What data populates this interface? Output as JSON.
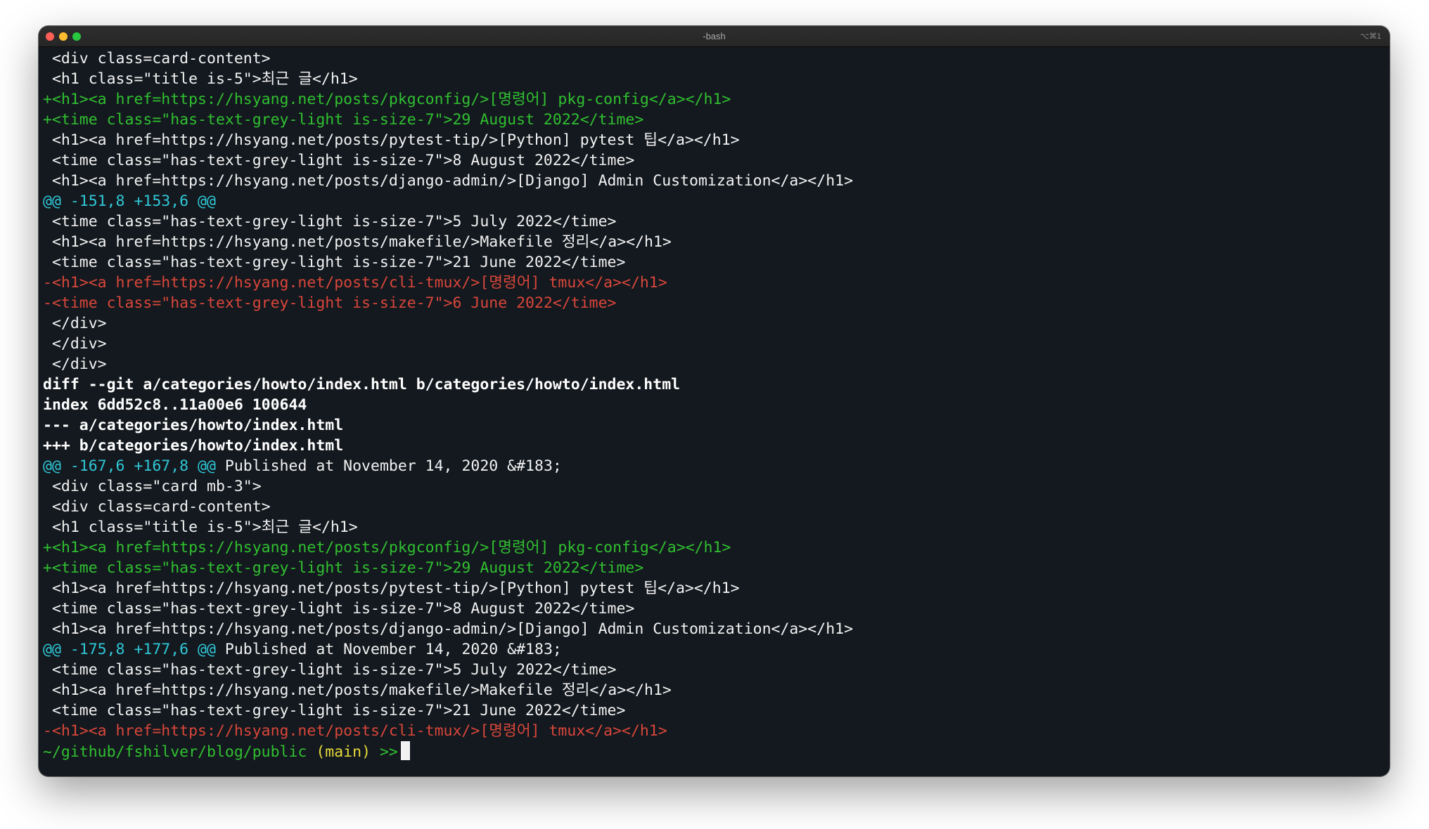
{
  "window": {
    "title": "-bash",
    "shortcut": "⌥⌘1"
  },
  "lines": {
    "l01": " <div class=card-content>",
    "l02": " <h1 class=\"title is-5\">최근 글</h1>",
    "l03": "+<h1><a href=https://hsyang.net/posts/pkgconfig/>[명령어] pkg-config</a></h1>",
    "l04": "+<time class=\"has-text-grey-light is-size-7\">29 August 2022</time>",
    "l05": " <h1><a href=https://hsyang.net/posts/pytest-tip/>[Python] pytest 팁</a></h1>",
    "l06": " <time class=\"has-text-grey-light is-size-7\">8 August 2022</time>",
    "l07": " <h1><a href=https://hsyang.net/posts/django-admin/>[Django] Admin Customization</a></h1>",
    "l08": "@@ -151,8 +153,6 @@",
    "l09": " <time class=\"has-text-grey-light is-size-7\">5 July 2022</time>",
    "l10": " <h1><a href=https://hsyang.net/posts/makefile/>Makefile 정리</a></h1>",
    "l11": " <time class=\"has-text-grey-light is-size-7\">21 June 2022</time>",
    "l12": "-<h1><a href=https://hsyang.net/posts/cli-tmux/>[명령어] tmux</a></h1>",
    "l13": "-<time class=\"has-text-grey-light is-size-7\">6 June 2022</time>",
    "l14": " </div>",
    "l15": " </div>",
    "l16": " </div>",
    "l17": "diff --git a/categories/howto/index.html b/categories/howto/index.html",
    "l18": "index 6dd52c8..11a00e6 100644",
    "l19": "--- a/categories/howto/index.html",
    "l20": "+++ b/categories/howto/index.html",
    "l21_hunk": "@@ -167,6 +167,8 @@",
    "l21_ctx": " Published at November 14, 2020 &#183;",
    "l22": " <div class=\"card mb-3\">",
    "l23": " <div class=card-content>",
    "l24": " <h1 class=\"title is-5\">최근 글</h1>",
    "l25": "+<h1><a href=https://hsyang.net/posts/pkgconfig/>[명령어] pkg-config</a></h1>",
    "l26": "+<time class=\"has-text-grey-light is-size-7\">29 August 2022</time>",
    "l27": " <h1><a href=https://hsyang.net/posts/pytest-tip/>[Python] pytest 팁</a></h1>",
    "l28": " <time class=\"has-text-grey-light is-size-7\">8 August 2022</time>",
    "l29": " <h1><a href=https://hsyang.net/posts/django-admin/>[Django] Admin Customization</a></h1>",
    "l30_hunk": "@@ -175,8 +177,6 @@",
    "l30_ctx": " Published at November 14, 2020 &#183;",
    "l31": " <time class=\"has-text-grey-light is-size-7\">5 July 2022</time>",
    "l32": " <h1><a href=https://hsyang.net/posts/makefile/>Makefile 정리</a></h1>",
    "l33": " <time class=\"has-text-grey-light is-size-7\">21 June 2022</time>",
    "l34": "-<h1><a href=https://hsyang.net/posts/cli-tmux/>[명령어] tmux</a></h1>"
  },
  "prompt": {
    "path": "~/github/fshilver/blog/public",
    "branch": "(main)",
    "symbol": ">>"
  },
  "colors": {
    "background": "#14191f",
    "added": "#30c030",
    "removed": "#d9463a",
    "hunk_header": "#2fc7d6",
    "branch": "#e6d93a",
    "text": "#f2f2f2"
  }
}
